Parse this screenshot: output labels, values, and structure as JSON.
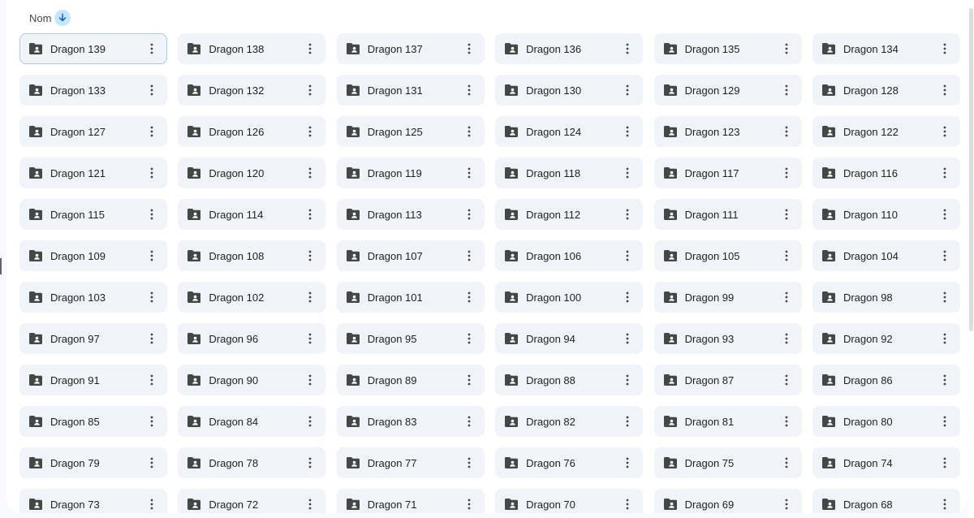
{
  "sort": {
    "label": "Nom",
    "direction_icon": "arrow-down-icon"
  },
  "folders": [
    {
      "name": "Dragon 139",
      "selected": true
    },
    {
      "name": "Dragon 138"
    },
    {
      "name": "Dragon 137"
    },
    {
      "name": "Dragon 136"
    },
    {
      "name": "Dragon 135"
    },
    {
      "name": "Dragon 134"
    },
    {
      "name": "Dragon 133"
    },
    {
      "name": "Dragon 132"
    },
    {
      "name": "Dragon 131"
    },
    {
      "name": "Dragon 130"
    },
    {
      "name": "Dragon 129"
    },
    {
      "name": "Dragon 128"
    },
    {
      "name": "Dragon 127"
    },
    {
      "name": "Dragon 126"
    },
    {
      "name": "Dragon 125"
    },
    {
      "name": "Dragon 124"
    },
    {
      "name": "Dragon 123"
    },
    {
      "name": "Dragon 122"
    },
    {
      "name": "Dragon 121"
    },
    {
      "name": "Dragon 120"
    },
    {
      "name": "Dragon 119"
    },
    {
      "name": "Dragon 118"
    },
    {
      "name": "Dragon 117"
    },
    {
      "name": "Dragon 116"
    },
    {
      "name": "Dragon 115"
    },
    {
      "name": "Dragon 114"
    },
    {
      "name": "Dragon 113"
    },
    {
      "name": "Dragon 112"
    },
    {
      "name": "Dragon 111"
    },
    {
      "name": "Dragon 110"
    },
    {
      "name": "Dragon 109"
    },
    {
      "name": "Dragon 108"
    },
    {
      "name": "Dragon 107"
    },
    {
      "name": "Dragon 106"
    },
    {
      "name": "Dragon 105"
    },
    {
      "name": "Dragon 104"
    },
    {
      "name": "Dragon 103"
    },
    {
      "name": "Dragon 102"
    },
    {
      "name": "Dragon 101"
    },
    {
      "name": "Dragon 100"
    },
    {
      "name": "Dragon 99"
    },
    {
      "name": "Dragon 98"
    },
    {
      "name": "Dragon 97"
    },
    {
      "name": "Dragon 96"
    },
    {
      "name": "Dragon 95"
    },
    {
      "name": "Dragon 94"
    },
    {
      "name": "Dragon 93"
    },
    {
      "name": "Dragon 92"
    },
    {
      "name": "Dragon 91"
    },
    {
      "name": "Dragon 90"
    },
    {
      "name": "Dragon 89"
    },
    {
      "name": "Dragon 88"
    },
    {
      "name": "Dragon 87"
    },
    {
      "name": "Dragon 86"
    },
    {
      "name": "Dragon 85"
    },
    {
      "name": "Dragon 84"
    },
    {
      "name": "Dragon 83"
    },
    {
      "name": "Dragon 82"
    },
    {
      "name": "Dragon 81"
    },
    {
      "name": "Dragon 80"
    },
    {
      "name": "Dragon 79"
    },
    {
      "name": "Dragon 78"
    },
    {
      "name": "Dragon 77"
    },
    {
      "name": "Dragon 76"
    },
    {
      "name": "Dragon 75"
    },
    {
      "name": "Dragon 74"
    },
    {
      "name": "Dragon 73"
    },
    {
      "name": "Dragon 72"
    },
    {
      "name": "Dragon 71"
    },
    {
      "name": "Dragon 70"
    },
    {
      "name": "Dragon 69"
    },
    {
      "name": "Dragon 68"
    }
  ],
  "icons": {
    "folder": "shared-folder-icon",
    "menu": "more-vert-icon"
  },
  "colors": {
    "card_bg": "#f0f4f9",
    "selected_border": "#a8c7fa",
    "sort_button_bg": "#c2e7ff",
    "icon_color": "#444746",
    "text_color": "#1f1f1f"
  }
}
